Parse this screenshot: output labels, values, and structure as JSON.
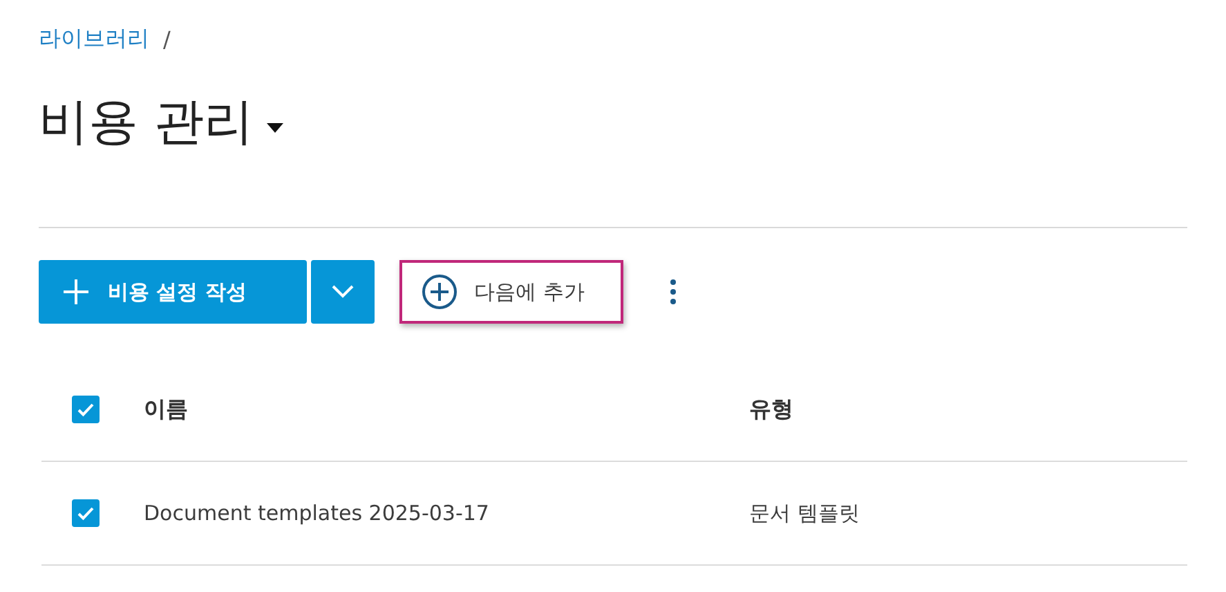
{
  "breadcrumb": {
    "items": [
      "라이브러리"
    ],
    "separator": "/"
  },
  "page_title": "비용 관리",
  "toolbar": {
    "primary_button": "비용 설정 작성",
    "add_button": {
      "label": "다음에 추가",
      "highlighted": true
    }
  },
  "table": {
    "select_all_checked": true,
    "columns": [
      "이름",
      "유형"
    ],
    "rows": [
      {
        "name": "Document templates 2025-03-17",
        "type": "문서 템플릿",
        "checked": true
      }
    ]
  }
}
